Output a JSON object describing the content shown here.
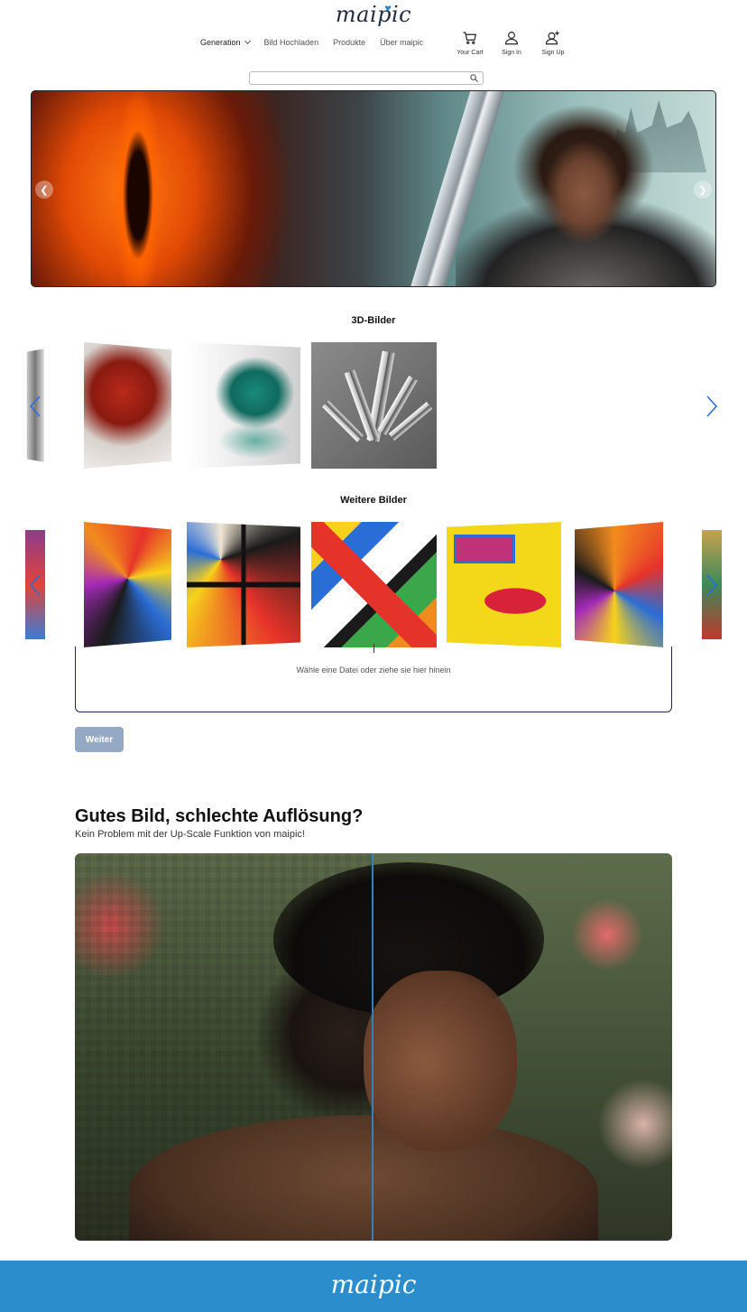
{
  "brand": {
    "logo": "maipic"
  },
  "nav": {
    "items": [
      {
        "label": "Generation",
        "has_dropdown": true
      },
      {
        "label": "Bild Hochladen"
      },
      {
        "label": "Produkte"
      },
      {
        "label": "Über maipic"
      }
    ]
  },
  "user_nav": {
    "cart": {
      "label": "Your Cart",
      "icon": "cart-icon"
    },
    "sign_in": {
      "label": "Sign In",
      "icon": "user-icon"
    },
    "sign_up": {
      "label": "Sign Up",
      "icon": "user-plus-icon"
    }
  },
  "search": {
    "value": "",
    "placeholder": "",
    "icon": "search-icon"
  },
  "hero": {
    "prev_icon": "chevron-left-icon",
    "next_icon": "chevron-right-icon"
  },
  "section_3d": {
    "title": "3D-Bilder"
  },
  "section_more": {
    "title": "Weitere Bilder"
  },
  "upload": {
    "text": "Wähle eine Datei oder ziehe sie hier hinein"
  },
  "weiter_button": {
    "label": "Weiter"
  },
  "upscale": {
    "heading": "Gutes Bild, schlechte Auflösung?",
    "subheading": "Kein Problem mit der Up-Scale Funktion von maipic!"
  },
  "footer": {
    "logo": "maipic"
  },
  "colors": {
    "accent": "#2c8dcc",
    "navy": "#1f2a44",
    "button_disabled": "#96a9c4"
  }
}
